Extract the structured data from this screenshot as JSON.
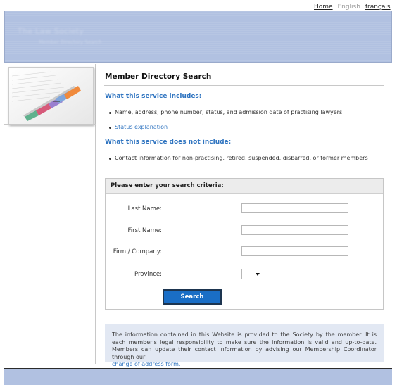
{
  "top_links": {
    "home": "Home",
    "english": "English",
    "french": "français"
  },
  "banner": {
    "title": "The Law Society",
    "subtitle": "Member Directory Search"
  },
  "main": {
    "title": "Member Directory Search",
    "includes_heading": "What this service includes:",
    "includes_items": [
      "Name, address, phone number, status, and admission date of practising lawyers",
      "Status explanation"
    ],
    "excludes_heading": "What this service does not include:",
    "excludes_items": [
      "Contact information for non-practising, retired, suspended, disbarred, or former members"
    ]
  },
  "search_form": {
    "heading": "Please enter your search criteria:",
    "last_name_label": "Last Name:",
    "last_name_value": "",
    "first_name_label": "First Name:",
    "first_name_value": "",
    "firm_label": "Firm / Company:",
    "firm_value": "",
    "province_label": "Province:",
    "province_value": "",
    "search_button": "Search"
  },
  "notice": {
    "text": "The information contained in this Website is provided to the Society by the member. It is each member's legal responsibility to make sure the information is valid and up-to-date. Members can update their contact information by advising our Membership Coordinator through our",
    "link": "change of address form."
  },
  "colors": {
    "banner": "#b1c1e1",
    "link_blue": "#2f74c0",
    "button_blue": "#1a6ec6",
    "notice_bg": "#e2e8f3"
  }
}
